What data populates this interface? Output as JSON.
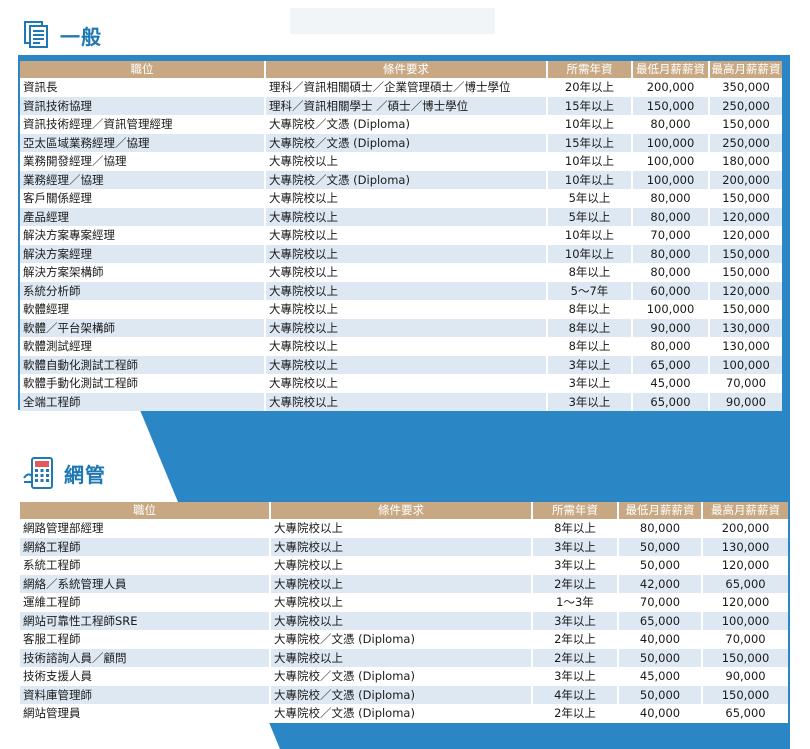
{
  "colors": {
    "accent": "#1f78b4",
    "header": "#c8a882",
    "stripe": "#dde8f3",
    "background_blue": "#2a86c4"
  },
  "general": {
    "title": "一般",
    "icon": "document-list-icon",
    "headers": [
      "職位",
      "條件要求",
      "所需年資",
      "最低月薪薪資",
      "最高月薪薪資"
    ],
    "rows": [
      [
        "資訊長",
        "理科／資訊相關碩士／企業管理碩士／博士學位",
        "20年以上",
        "200,000",
        "350,000"
      ],
      [
        "資訊技術協理",
        "理科／資訊相關學士 ／碩士／博士學位",
        "15年以上",
        "150,000",
        "250,000"
      ],
      [
        "資訊技術經理／資訊管理經理",
        "大專院校／文憑 (Diploma)",
        "10年以上",
        "80,000",
        "150,000"
      ],
      [
        "亞太區域業務經理／協理",
        "大專院校／文憑 (Diploma)",
        "15年以上",
        "100,000",
        "250,000"
      ],
      [
        "業務開發經理／協理",
        "大專院校以上",
        "10年以上",
        "100,000",
        "180,000"
      ],
      [
        "業務經理／協理",
        "大專院校／文憑 (Diploma)",
        "10年以上",
        "100,000",
        "200,000"
      ],
      [
        "客戶關係經理",
        "大專院校以上",
        "5年以上",
        "80,000",
        "150,000"
      ],
      [
        "產品經理",
        "大專院校以上",
        "5年以上",
        "80,000",
        "120,000"
      ],
      [
        "解決方案專案經理",
        "大專院校以上",
        "10年以上",
        "70,000",
        "120,000"
      ],
      [
        "解決方案經理",
        "大專院校以上",
        "10年以上",
        "80,000",
        "150,000"
      ],
      [
        "解決方案架構師",
        "大專院校以上",
        "8年以上",
        "80,000",
        "150,000"
      ],
      [
        "系統分析師",
        "大專院校以上",
        "5〜7年",
        "60,000",
        "120,000"
      ],
      [
        "軟體經理",
        "大專院校以上",
        "8年以上",
        "100,000",
        "150,000"
      ],
      [
        "軟體／平台架構師",
        "大專院校以上",
        "8年以上",
        "90,000",
        "130,000"
      ],
      [
        "軟體測試經理",
        "大專院校以上",
        "8年以上",
        "80,000",
        "130,000"
      ],
      [
        "軟體自動化測試工程師",
        "大專院校以上",
        "3年以上",
        "65,000",
        "100,000"
      ],
      [
        "軟體手動化測試工程師",
        "大專院校以上",
        "3年以上",
        "45,000",
        "70,000"
      ],
      [
        "全端工程師",
        "大專院校以上",
        "3年以上",
        "65,000",
        "90,000"
      ]
    ]
  },
  "network": {
    "title": "網管",
    "icon": "network-server-icon",
    "headers": [
      "職位",
      "條件要求",
      "所需年資",
      "最低月薪薪資",
      "最高月薪薪資"
    ],
    "rows": [
      [
        "網路管理部經理",
        "大專院校以上",
        "8年以上",
        "80,000",
        "200,000"
      ],
      [
        "網絡工程師",
        "大專院校以上",
        "3年以上",
        "50,000",
        "130,000"
      ],
      [
        "系統工程師",
        "大專院校以上",
        "3年以上",
        "50,000",
        "120,000"
      ],
      [
        "網絡／系統管理人員",
        "大專院校以上",
        "2年以上",
        "42,000",
        "65,000"
      ],
      [
        "運維工程師",
        "大專院校以上",
        "1〜3年",
        "70,000",
        "120,000"
      ],
      [
        "網站可靠性工程師SRE",
        "大專院校以上",
        "3年以上",
        "65,000",
        "100,000"
      ],
      [
        "客服工程師",
        "大專院校／文憑 (Diploma)",
        "2年以上",
        "40,000",
        "70,000"
      ],
      [
        "技術諮詢人員／顧問",
        "大專院校以上",
        "2年以上",
        "50,000",
        "150,000"
      ],
      [
        "技術支援人員",
        "大專院校／文憑 (Diploma)",
        "3年以上",
        "45,000",
        "90,000"
      ],
      [
        "資料庫管理師",
        "大專院校／文憑 (Diploma)",
        "4年以上",
        "50,000",
        "150,000"
      ],
      [
        "網站管理員",
        "大專院校／文憑 (Diploma)",
        "2年以上",
        "40,000",
        "65,000"
      ]
    ]
  }
}
